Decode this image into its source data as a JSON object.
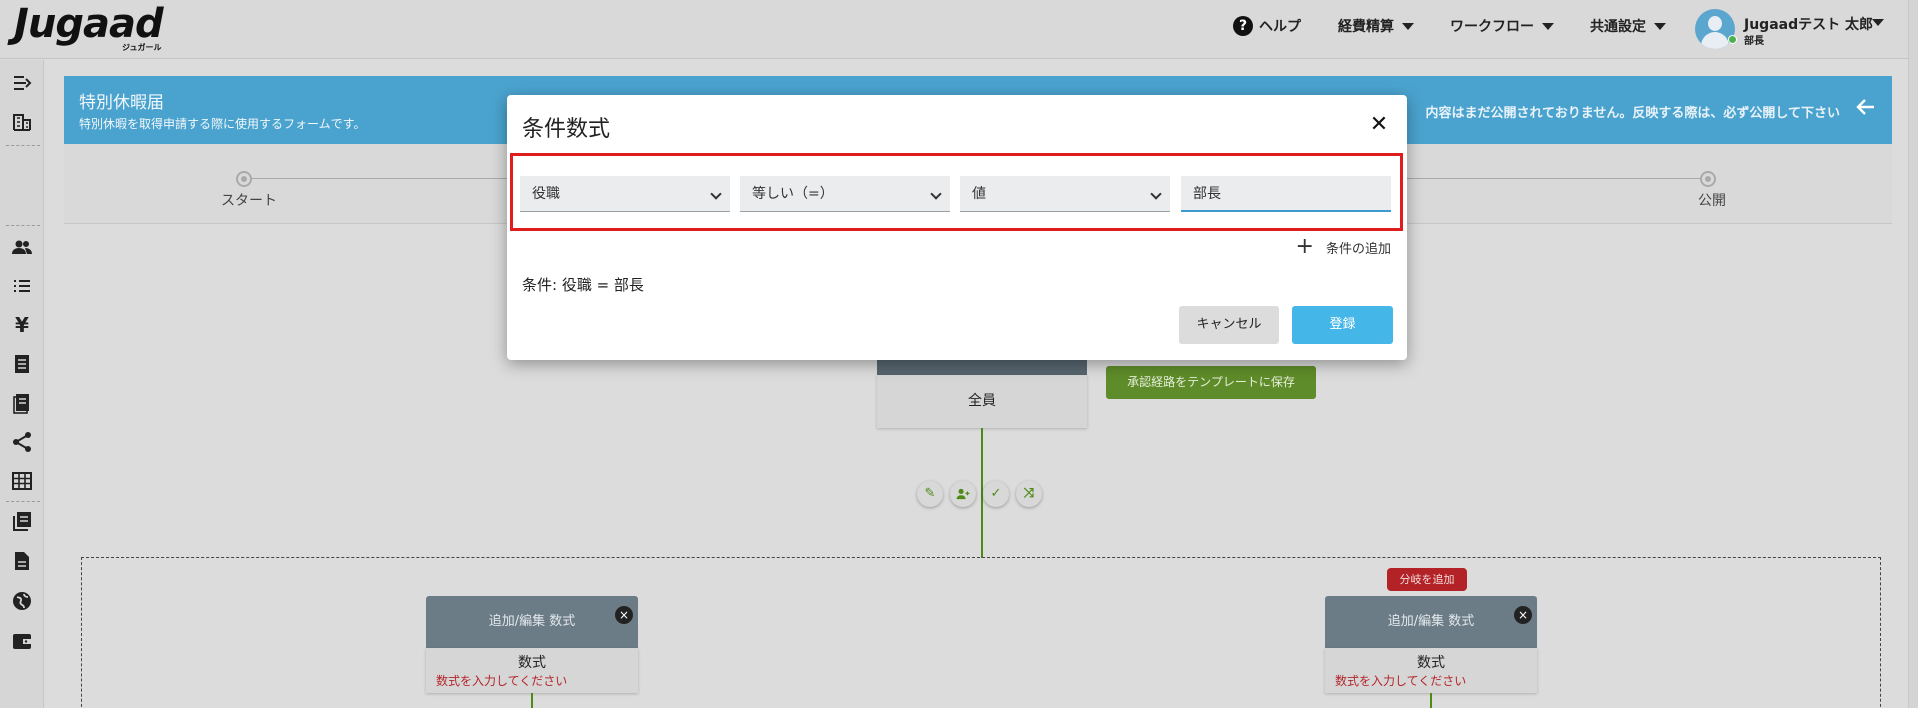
{
  "app": {
    "logo": "Jugaad",
    "logo_sub": "ジュガール"
  },
  "topnav": {
    "help": "ヘルプ",
    "expense": "経費精算",
    "workflow": "ワークフロー",
    "common_settings": "共通設定",
    "user_name": "Jugaadテスト 太郎",
    "user_role": "部長"
  },
  "form": {
    "title": "特別休暇届",
    "description": "特別休暇を取得申請する際に使用するフォームです。",
    "notice": "内容はまだ公開されておりません。反映する際は、必ず公開して下さい"
  },
  "steps": [
    "スタート",
    "公開"
  ],
  "flow": {
    "approver_label": "全員",
    "save_template": "承認経路をテンプレートに保存",
    "add_branch": "分岐を追加",
    "formula_card_header": "追加/編集 数式",
    "formula_card_title": "数式",
    "formula_card_hint": "数式を入力してください"
  },
  "modal": {
    "title": "条件数式",
    "field_select": "役職",
    "operator_select": "等しい（=）",
    "type_select": "値",
    "value_input": "部長",
    "add_condition": "条件の追加",
    "condition_summary": "条件: 役職 = 部長",
    "cancel": "キャンセル",
    "submit": "登録"
  },
  "colors": {
    "header_blue": "#4aa3cf",
    "submit_blue": "#45b6e8",
    "highlight_red": "#e01d1d",
    "flow_green": "#4d8a16",
    "danger_red": "#b32226"
  }
}
